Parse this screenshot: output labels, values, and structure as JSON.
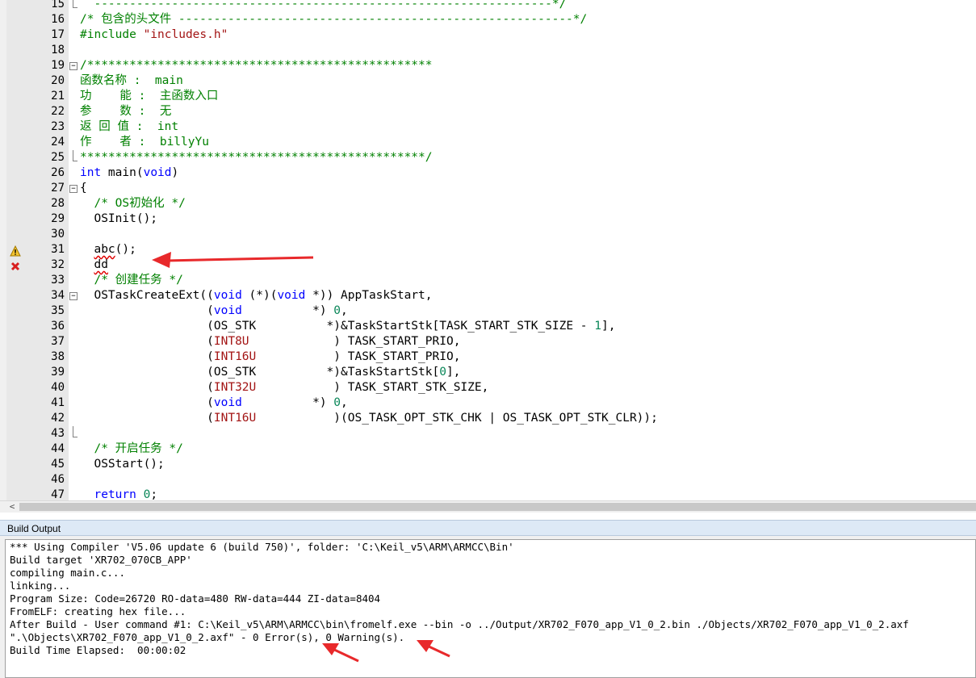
{
  "editor": {
    "lines": [
      {
        "n": "15",
        "segs": [
          {
            "t": "  -----------------------------------------------------------------*/",
            "c": "comment"
          }
        ]
      },
      {
        "n": "16",
        "segs": [
          {
            "t": "/* 包含的头文件 --------------------------------------------------------*/",
            "c": "comment"
          }
        ]
      },
      {
        "n": "17",
        "segs": [
          {
            "t": "#include ",
            "c": "comment"
          },
          {
            "t": "\"includes.h\"",
            "c": "string"
          }
        ]
      },
      {
        "n": "18",
        "segs": []
      },
      {
        "n": "19",
        "segs": [
          {
            "t": "/*************************************************",
            "c": "comment"
          }
        ]
      },
      {
        "n": "20",
        "segs": [
          {
            "t": "函数名称 :  main",
            "c": "comment"
          }
        ]
      },
      {
        "n": "21",
        "segs": [
          {
            "t": "功    能 :  主函数入口",
            "c": "comment"
          }
        ]
      },
      {
        "n": "22",
        "segs": [
          {
            "t": "参    数 :  无",
            "c": "comment"
          }
        ]
      },
      {
        "n": "23",
        "segs": [
          {
            "t": "返 回 值 :  int",
            "c": "comment"
          }
        ]
      },
      {
        "n": "24",
        "segs": [
          {
            "t": "作    者 :  billyYu",
            "c": "comment"
          }
        ]
      },
      {
        "n": "25",
        "segs": [
          {
            "t": "*************************************************/",
            "c": "comment"
          }
        ]
      },
      {
        "n": "26",
        "segs": [
          {
            "t": "int",
            "c": "keyword"
          },
          {
            "t": " main(",
            "c": "plain"
          },
          {
            "t": "void",
            "c": "keyword"
          },
          {
            "t": ")",
            "c": "plain"
          }
        ]
      },
      {
        "n": "27",
        "segs": [
          {
            "t": "{",
            "c": "plain"
          }
        ]
      },
      {
        "n": "28",
        "segs": [
          {
            "t": "  /* OS初始化 */",
            "c": "comment"
          }
        ]
      },
      {
        "n": "29",
        "segs": [
          {
            "t": "  OSInit();",
            "c": "plain"
          }
        ]
      },
      {
        "n": "30",
        "segs": []
      },
      {
        "n": "31",
        "segs": [
          {
            "t": "  ",
            "c": "plain"
          },
          {
            "t": "abc",
            "c": "squiggle"
          },
          {
            "t": "();",
            "c": "plain"
          }
        ]
      },
      {
        "n": "32",
        "segs": [
          {
            "t": "  ",
            "c": "plain"
          },
          {
            "t": "dd",
            "c": "squiggle"
          }
        ]
      },
      {
        "n": "33",
        "segs": [
          {
            "t": "  /* 创建任务 */",
            "c": "comment"
          }
        ]
      },
      {
        "n": "34",
        "segs": [
          {
            "t": "  OSTaskCreateExt((",
            "c": "plain"
          },
          {
            "t": "void",
            "c": "keyword"
          },
          {
            "t": " (*)(",
            "c": "plain"
          },
          {
            "t": "void",
            "c": "keyword"
          },
          {
            "t": " *)) AppTaskStart,",
            "c": "plain"
          }
        ]
      },
      {
        "n": "35",
        "segs": [
          {
            "t": "                  (",
            "c": "plain"
          },
          {
            "t": "void",
            "c": "keyword"
          },
          {
            "t": "          *) ",
            "c": "plain"
          },
          {
            "t": "0",
            "c": "num"
          },
          {
            "t": ",",
            "c": "plain"
          }
        ]
      },
      {
        "n": "36",
        "segs": [
          {
            "t": "                  (OS_STK          *)&TaskStartStk[TASK_START_STK_SIZE - ",
            "c": "plain"
          },
          {
            "t": "1",
            "c": "num"
          },
          {
            "t": "],",
            "c": "plain"
          }
        ]
      },
      {
        "n": "37",
        "segs": [
          {
            "t": "                  (",
            "c": "plain"
          },
          {
            "t": "INT8U",
            "c": "type"
          },
          {
            "t": "            ) TASK_START_PRIO,",
            "c": "plain"
          }
        ]
      },
      {
        "n": "38",
        "segs": [
          {
            "t": "                  (",
            "c": "plain"
          },
          {
            "t": "INT16U",
            "c": "type"
          },
          {
            "t": "           ) TASK_START_PRIO,",
            "c": "plain"
          }
        ]
      },
      {
        "n": "39",
        "segs": [
          {
            "t": "                  (OS_STK          *)&TaskStartStk[",
            "c": "plain"
          },
          {
            "t": "0",
            "c": "num"
          },
          {
            "t": "],",
            "c": "plain"
          }
        ]
      },
      {
        "n": "40",
        "segs": [
          {
            "t": "                  (",
            "c": "plain"
          },
          {
            "t": "INT32U",
            "c": "type"
          },
          {
            "t": "           ) TASK_START_STK_SIZE,",
            "c": "plain"
          }
        ]
      },
      {
        "n": "41",
        "segs": [
          {
            "t": "                  (",
            "c": "plain"
          },
          {
            "t": "void",
            "c": "keyword"
          },
          {
            "t": "          *) ",
            "c": "plain"
          },
          {
            "t": "0",
            "c": "num"
          },
          {
            "t": ",",
            "c": "plain"
          }
        ]
      },
      {
        "n": "42",
        "segs": [
          {
            "t": "                  (",
            "c": "plain"
          },
          {
            "t": "INT16U",
            "c": "type"
          },
          {
            "t": "           )(OS_TASK_OPT_STK_CHK | OS_TASK_OPT_STK_CLR));",
            "c": "plain"
          }
        ]
      },
      {
        "n": "43",
        "segs": []
      },
      {
        "n": "44",
        "segs": [
          {
            "t": "  /* 开启任务 */",
            "c": "comment"
          }
        ]
      },
      {
        "n": "45",
        "segs": [
          {
            "t": "  OSStart();",
            "c": "plain"
          }
        ]
      },
      {
        "n": "46",
        "segs": []
      },
      {
        "n": "47",
        "segs": [
          {
            "t": "  ",
            "c": "plain"
          },
          {
            "t": "return",
            "c": "keyword"
          },
          {
            "t": " ",
            "c": "plain"
          },
          {
            "t": "0",
            "c": "num"
          },
          {
            "t": ";",
            "c": "plain"
          }
        ]
      }
    ],
    "markers": {
      "31": "warning-icon",
      "32": "error-icon"
    },
    "fold_boxes": [
      "19",
      "27",
      "34"
    ],
    "fold_ends": [
      "15",
      "25",
      "43"
    ]
  },
  "hscroll": {
    "left_arrow": "<"
  },
  "build_output": {
    "title": "Build Output",
    "lines": [
      "*** Using Compiler 'V5.06 update 6 (build 750)', folder: 'C:\\Keil_v5\\ARM\\ARMCC\\Bin'",
      "Build target 'XR702_070CB_APP'",
      "compiling main.c...",
      "linking...",
      "Program Size: Code=26720 RO-data=480 RW-data=444 ZI-data=8404",
      "FromELF: creating hex file...",
      "After Build - User command #1: C:\\Keil_v5\\ARM\\ARMCC\\bin\\fromelf.exe --bin -o ../Output/XR702_F070_app_V1_0_2.bin ./Objects/XR702_F070_app_V1_0_2.axf",
      "\".\\Objects\\XR702_F070_app_V1_0_2.axf\" - 0 Error(s), 0 Warning(s).",
      "Build Time Elapsed:  00:00:02"
    ]
  },
  "colors": {
    "comment": "#008000",
    "keyword": "#0000ff",
    "type": "#a31515",
    "num": "#098658",
    "arrow": "#e8292b"
  }
}
